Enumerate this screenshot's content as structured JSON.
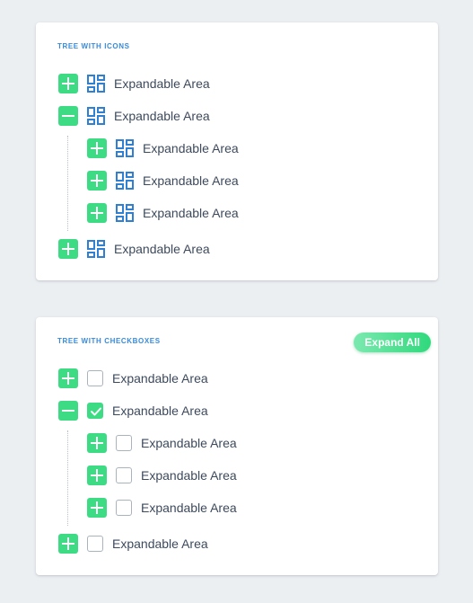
{
  "colors": {
    "accent": "#3ddc84",
    "title": "#3a8ad6",
    "icon": "#2f7fd2",
    "text": "#3d4a5c",
    "background": "#eceff2"
  },
  "tree_icons": {
    "title": "TREE WITH ICONS",
    "icon": "dashboard-icon",
    "items": [
      {
        "label": "Expandable Area",
        "state": "collapsed",
        "level": 0
      },
      {
        "label": "Expandable Area",
        "state": "expanded",
        "level": 0
      },
      {
        "label": "Expandable Area",
        "state": "collapsed",
        "level": 1
      },
      {
        "label": "Expandable Area",
        "state": "collapsed",
        "level": 1
      },
      {
        "label": "Expandable Area",
        "state": "collapsed",
        "level": 1
      },
      {
        "label": "Expandable Area",
        "state": "collapsed",
        "level": 0
      }
    ]
  },
  "tree_checkboxes": {
    "title": "TREE WITH CHECKBOXES",
    "expand_all_label": "Expand All",
    "items": [
      {
        "label": "Expandable Area",
        "state": "collapsed",
        "checked": false,
        "level": 0
      },
      {
        "label": "Expandable Area",
        "state": "expanded",
        "checked": true,
        "level": 0
      },
      {
        "label": "Expandable Area",
        "state": "collapsed",
        "checked": false,
        "level": 1
      },
      {
        "label": "Expandable Area",
        "state": "collapsed",
        "checked": false,
        "level": 1
      },
      {
        "label": "Expandable Area",
        "state": "collapsed",
        "checked": false,
        "level": 1
      },
      {
        "label": "Expandable Area",
        "state": "collapsed",
        "checked": false,
        "level": 0
      }
    ]
  }
}
